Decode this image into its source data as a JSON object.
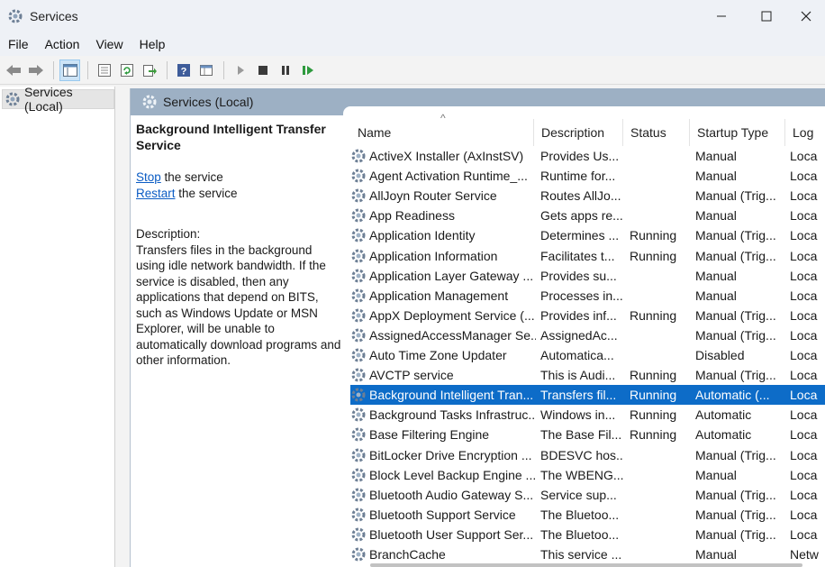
{
  "window": {
    "title": "Services"
  },
  "menu": [
    "File",
    "Action",
    "View",
    "Help"
  ],
  "tree": {
    "root_label": "Services (Local)"
  },
  "panel": {
    "header": "Services (Local)"
  },
  "details": {
    "service_name": "Background Intelligent Transfer Service",
    "stop_link": "Stop",
    "stop_suffix": " the service",
    "restart_link": "Restart",
    "restart_suffix": " the service",
    "description_label": "Description:",
    "description_text": "Transfers files in the background using idle network bandwidth. If the service is disabled, then any applications that depend on BITS, such as Windows Update or MSN Explorer, will be unable to automatically download programs and other information."
  },
  "columns": [
    "Name",
    "Description",
    "Status",
    "Startup Type",
    "Log"
  ],
  "services": [
    {
      "name": "ActiveX Installer (AxInstSV)",
      "desc": "Provides Us...",
      "status": "",
      "startup": "Manual",
      "log": "Loca"
    },
    {
      "name": "Agent Activation Runtime_...",
      "desc": "Runtime for...",
      "status": "",
      "startup": "Manual",
      "log": "Loca"
    },
    {
      "name": "AllJoyn Router Service",
      "desc": "Routes AllJo...",
      "status": "",
      "startup": "Manual (Trig...",
      "log": "Loca"
    },
    {
      "name": "App Readiness",
      "desc": "Gets apps re...",
      "status": "",
      "startup": "Manual",
      "log": "Loca"
    },
    {
      "name": "Application Identity",
      "desc": "Determines ...",
      "status": "Running",
      "startup": "Manual (Trig...",
      "log": "Loca"
    },
    {
      "name": "Application Information",
      "desc": "Facilitates t...",
      "status": "Running",
      "startup": "Manual (Trig...",
      "log": "Loca"
    },
    {
      "name": "Application Layer Gateway ...",
      "desc": "Provides su...",
      "status": "",
      "startup": "Manual",
      "log": "Loca"
    },
    {
      "name": "Application Management",
      "desc": "Processes in...",
      "status": "",
      "startup": "Manual",
      "log": "Loca"
    },
    {
      "name": "AppX Deployment Service (...",
      "desc": "Provides inf...",
      "status": "Running",
      "startup": "Manual (Trig...",
      "log": "Loca"
    },
    {
      "name": "AssignedAccessManager Se...",
      "desc": "AssignedAc...",
      "status": "",
      "startup": "Manual (Trig...",
      "log": "Loca"
    },
    {
      "name": "Auto Time Zone Updater",
      "desc": "Automatica...",
      "status": "",
      "startup": "Disabled",
      "log": "Loca"
    },
    {
      "name": "AVCTP service",
      "desc": "This is Audi...",
      "status": "Running",
      "startup": "Manual (Trig...",
      "log": "Loca"
    },
    {
      "name": "Background Intelligent Tran...",
      "desc": "Transfers fil...",
      "status": "Running",
      "startup": "Automatic (...",
      "log": "Loca",
      "selected": true
    },
    {
      "name": "Background Tasks Infrastruc...",
      "desc": "Windows in...",
      "status": "Running",
      "startup": "Automatic",
      "log": "Loca"
    },
    {
      "name": "Base Filtering Engine",
      "desc": "The Base Fil...",
      "status": "Running",
      "startup": "Automatic",
      "log": "Loca"
    },
    {
      "name": "BitLocker Drive Encryption ...",
      "desc": "BDESVC hos...",
      "status": "",
      "startup": "Manual (Trig...",
      "log": "Loca"
    },
    {
      "name": "Block Level Backup Engine ...",
      "desc": "The WBENG...",
      "status": "",
      "startup": "Manual",
      "log": "Loca"
    },
    {
      "name": "Bluetooth Audio Gateway S...",
      "desc": "Service sup...",
      "status": "",
      "startup": "Manual (Trig...",
      "log": "Loca"
    },
    {
      "name": "Bluetooth Support Service",
      "desc": "The Bluetoo...",
      "status": "",
      "startup": "Manual (Trig...",
      "log": "Loca"
    },
    {
      "name": "Bluetooth User Support Ser...",
      "desc": "The Bluetoo...",
      "status": "",
      "startup": "Manual (Trig...",
      "log": "Loca"
    },
    {
      "name": "BranchCache",
      "desc": "This service ...",
      "status": "",
      "startup": "Manual",
      "log": "Netw"
    }
  ],
  "colors": {
    "selection": "#0d6cc8",
    "header_band": "#9db0c4",
    "link": "#0b5cc4"
  },
  "icons": [
    "gear-icon",
    "back-arrow-icon",
    "forward-arrow-icon",
    "console-tree-icon",
    "properties-icon",
    "refresh-icon",
    "export-icon",
    "help-icon",
    "view-icon",
    "play-icon",
    "stop-icon",
    "pause-icon",
    "resume-icon"
  ]
}
